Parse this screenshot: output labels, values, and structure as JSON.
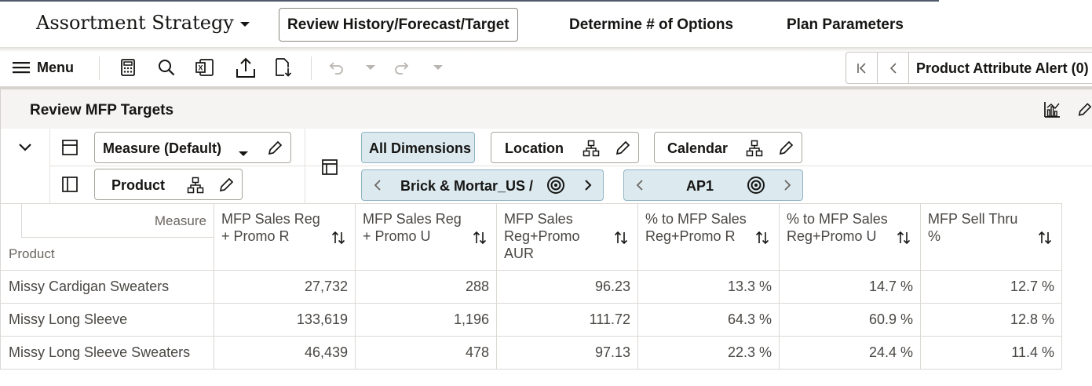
{
  "header": {
    "app_title": "Assortment Strategy",
    "tabs": [
      {
        "label": "Review History/Forecast/Target",
        "active": true
      },
      {
        "label": "Determine # of Options",
        "active": false
      },
      {
        "label": "Plan Parameters",
        "active": false
      }
    ]
  },
  "toolbar": {
    "menu_label": "Menu",
    "icons": [
      "calculator-icon",
      "search-icon",
      "excel-icon",
      "upload-icon",
      "export-file-icon",
      "undo-icon",
      "redo-icon"
    ],
    "alert_label": "Product Attribute Alert (0)"
  },
  "panel": {
    "title": "Review MFP Targets"
  },
  "pivot": {
    "measure_chip": "Measure (Default)",
    "product_chip": "Product",
    "all_dimensions": "All Dimensions",
    "location_chip": "Location",
    "calendar_chip": "Calendar",
    "location_value": "Brick & Mortar_US /",
    "calendar_value": "AP1"
  },
  "grid": {
    "measure_label": "Measure",
    "product_label": "Product",
    "columns": [
      "MFP Sales Reg + Promo R",
      "MFP Sales Reg + Promo U",
      "MFP Sales Reg+Promo AUR",
      "% to MFP Sales Reg+Promo R",
      "% to MFP Sales Reg+Promo U",
      "MFP Sell Thru %"
    ],
    "rows": [
      {
        "product": "Missy Cardigan Sweaters",
        "values": [
          "27,732",
          "288",
          "96.23",
          "13.3 %",
          "14.7 %",
          "12.7 %"
        ]
      },
      {
        "product": "Missy Long Sleeve",
        "values": [
          "133,619",
          "1,196",
          "111.72",
          "64.3 %",
          "60.9 %",
          "12.8 %"
        ]
      },
      {
        "product": "Missy Long Sleeve Sweaters",
        "values": [
          "46,439",
          "478",
          "97.13",
          "22.3 %",
          "24.4 %",
          "11.4 %"
        ]
      }
    ]
  },
  "colors": {
    "accent_chip_bg": "#dceaf0",
    "accent_chip_border": "#8fb3c3",
    "text": "#161513",
    "panel_bg": "#f5f4f2"
  }
}
